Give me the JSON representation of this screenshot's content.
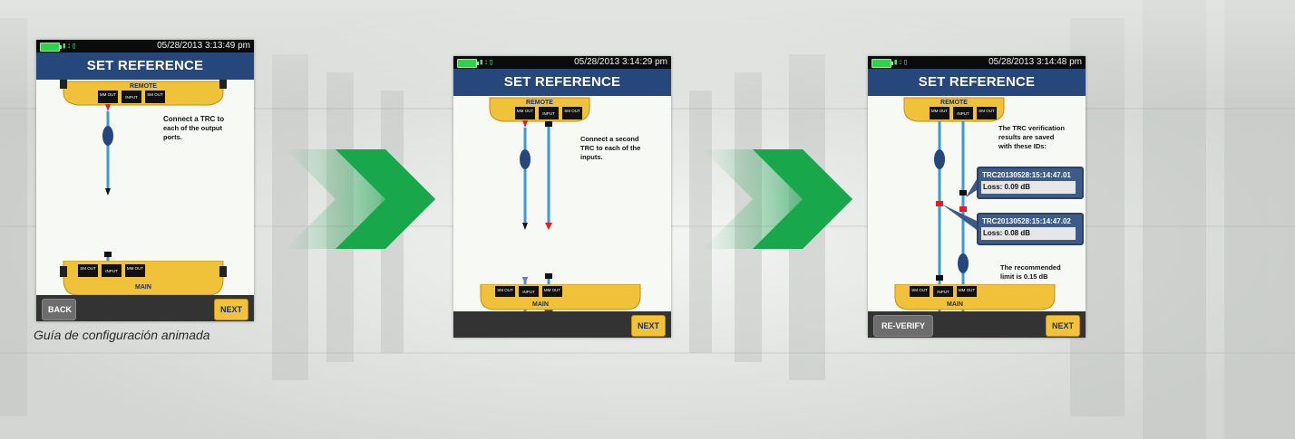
{
  "caption": "Guía de configuración animada",
  "colors": {
    "title_bar": "#25477c",
    "status_bar": "#0b0b0b",
    "arrow_green": "#16a34a",
    "next_button": "#f2c23a",
    "remote_unit": "#f0c23a",
    "cable_blue": "#3a9ad8",
    "connector_red": "#e11d2a"
  },
  "screens": [
    {
      "status": {
        "time": "05/28/2013 3:13:49 pm"
      },
      "title": "SET REFERENCE",
      "remote": {
        "label": "REMOTE",
        "ports": [
          "MM OUT",
          "INPUT",
          "SM OUT"
        ]
      },
      "main": {
        "label": "MAIN",
        "ports": [
          "SM OUT",
          "INPUT",
          "MM OUT"
        ]
      },
      "message": "Connect a TRC to each of the output ports.",
      "buttons": {
        "back": "BACK",
        "next": "NEXT"
      }
    },
    {
      "status": {
        "time": "05/28/2013 3:14:29 pm"
      },
      "title": "SET REFERENCE",
      "remote": {
        "label": "REMOTE",
        "ports": [
          "MM OUT",
          "INPUT",
          "SM OUT"
        ]
      },
      "main": {
        "label": "MAIN",
        "ports": [
          "SM OUT",
          "INPUT",
          "MM OUT"
        ]
      },
      "message": "Connect a second TRC to each of the inputs.",
      "buttons": {
        "next": "NEXT"
      }
    },
    {
      "status": {
        "time": "05/28/2013 3:14:48 pm"
      },
      "title": "SET REFERENCE",
      "remote": {
        "label": "REMOTE",
        "ports": [
          "MM OUT",
          "INPUT",
          "SM OUT"
        ]
      },
      "main": {
        "label": "MAIN",
        "ports": [
          "SM OUT",
          "INPUT",
          "MM OUT"
        ]
      },
      "message": "The TRC verification results are saved with these IDs:",
      "results": [
        {
          "id": "TRC20130528:15:14:47.01",
          "loss": "Loss: 0.09 dB"
        },
        {
          "id": "TRC20130528:15:14:47.02",
          "loss": "Loss: 0.08 dB"
        }
      ],
      "message2": "The recommended limit is 0.15 dB",
      "buttons": {
        "reverify": "RE-VERIFY",
        "next": "NEXT"
      }
    }
  ]
}
